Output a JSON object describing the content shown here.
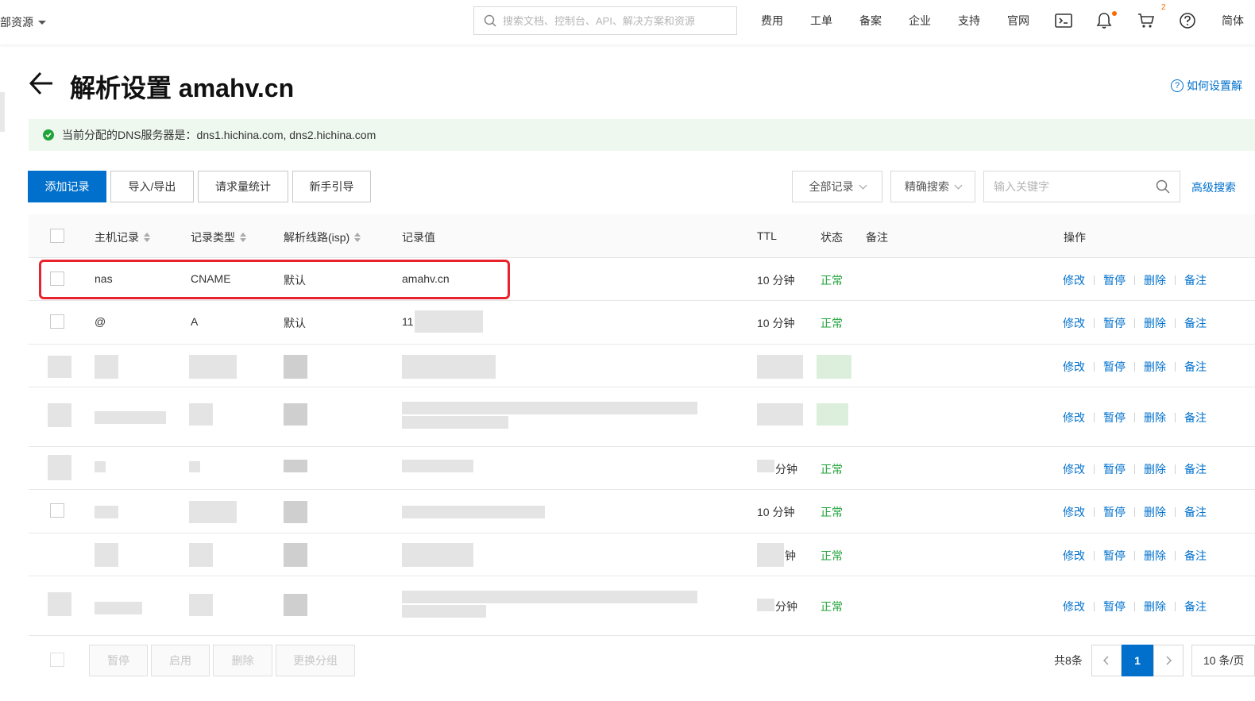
{
  "topbar": {
    "resources_label": "部资源",
    "search_placeholder": "搜索文档、控制台、API、解决方案和资源",
    "nav": [
      "费用",
      "工单",
      "备案",
      "企业",
      "支持",
      "官网"
    ],
    "cart_count": "2",
    "lang": "简体"
  },
  "page": {
    "title": "解析设置 amahv.cn",
    "help_link": "如何设置解"
  },
  "dns_banner": {
    "text": "当前分配的DNS服务器是：dns1.hichina.com, dns2.hichina.com"
  },
  "toolbar": {
    "add_record": "添加记录",
    "import_export": "导入/导出",
    "request_stats": "请求量统计",
    "beginner_guide": "新手引导",
    "record_filter": "全部记录",
    "search_mode": "精确搜索",
    "keyword_placeholder": "输入关键字",
    "advanced_search": "高级搜索"
  },
  "table": {
    "headers": {
      "host": "主机记录",
      "type": "记录类型",
      "line": "解析线路(isp)",
      "value": "记录值",
      "ttl": "TTL",
      "status": "状态",
      "remark": "备注",
      "actions": "操作"
    },
    "rows": [
      {
        "host": "nas",
        "type": "CNAME",
        "line": "默认",
        "value": "amahv.cn",
        "ttl": "10 分钟",
        "status": "正常"
      },
      {
        "host": "@",
        "type": "A",
        "line": "默认",
        "value": "11",
        "ttl": "10 分钟",
        "status": "正常"
      },
      {
        "host": "",
        "type": "",
        "line": "",
        "value": "",
        "ttl": "",
        "status": ""
      },
      {
        "host": "",
        "type": "",
        "line": "",
        "value": "",
        "ttl": "",
        "status": ""
      },
      {
        "host": "",
        "type": "",
        "line": "",
        "value": "",
        "ttl": "分钟",
        "status": "正常"
      },
      {
        "host": "",
        "type": "",
        "line": "",
        "value": "",
        "ttl": "10 分钟",
        "status": "正常"
      },
      {
        "host": "",
        "type": "",
        "line": "",
        "value": "",
        "ttl": "钟",
        "status": "正常"
      },
      {
        "host": "",
        "type": "",
        "line": "",
        "value": "",
        "ttl": "分钟",
        "status": "正常"
      }
    ],
    "action_labels": {
      "edit": "修改",
      "pause": "暂停",
      "delete": "删除",
      "remark": "备注"
    }
  },
  "footer": {
    "pause": "暂停",
    "enable": "启用",
    "delete": "删除",
    "change_group": "更换分组",
    "total": "共8条",
    "current_page": "1",
    "page_size": "10 条/页"
  },
  "colors": {
    "accent": "#0070cc",
    "ok_green": "#21a33a",
    "highlight_red": "#e8232e",
    "banner_bg": "#eef8ef"
  }
}
